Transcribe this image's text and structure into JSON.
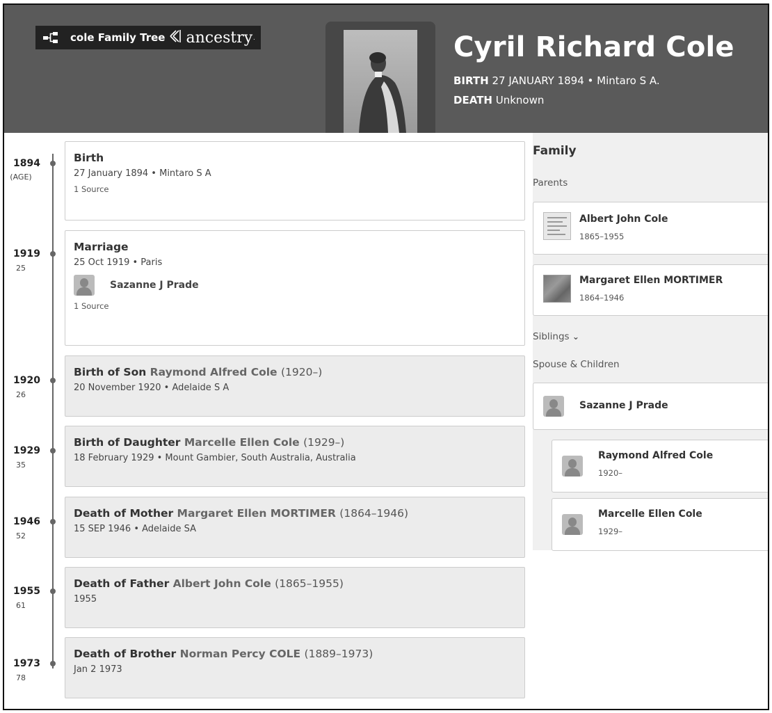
{
  "header": {
    "tree_name": "cole Family Tree",
    "brand": "ancestry",
    "person_name": "Cyril Richard Cole",
    "birth_label": "BIRTH",
    "birth_value": "27 JANUARY 1894 • Mintaro S A.",
    "death_label": "DEATH",
    "death_value": "Unknown"
  },
  "timeline": [
    {
      "year": "1894",
      "age": "(AGE)",
      "title": "Birth",
      "sub": "27 January 1894 • Mintaro S A",
      "source": "1 Source"
    },
    {
      "year": "1919",
      "age": "25",
      "title": "Marriage",
      "sub": "25 Oct 1919 • Paris",
      "spouse": "Sazanne J Prade",
      "source": "1 Source"
    },
    {
      "year": "1920",
      "age": "26",
      "title": "Birth of Son",
      "rel_name": "Raymond Alfred Cole",
      "dates": "(1920–)",
      "sub": "20 November 1920 • Adelaide S A"
    },
    {
      "year": "1929",
      "age": "35",
      "title": "Birth of Daughter",
      "rel_name": "Marcelle Ellen Cole",
      "dates": "(1929–)",
      "sub": "18 February 1929 • Mount Gambier, South Australia, Australia"
    },
    {
      "year": "1946",
      "age": "52",
      "title": "Death of Mother",
      "rel_name": "Margaret Ellen MORTIMER",
      "dates": "(1864–1946)",
      "sub": "15 SEP 1946 • Adelaide SA"
    },
    {
      "year": "1955",
      "age": "61",
      "title": "Death of Father",
      "rel_name": "Albert John Cole",
      "dates": "(1865–1955)",
      "sub": "1955"
    },
    {
      "year": "1973",
      "age": "78",
      "title": "Death of Brother",
      "rel_name": "Norman Percy COLE",
      "dates": "(1889–1973)",
      "sub": "Jan 2 1973"
    }
  ],
  "family": {
    "title": "Family",
    "parents_label": "Parents",
    "parents": [
      {
        "name": "Albert John Cole",
        "years": "1865–1955"
      },
      {
        "name": "Margaret Ellen MORTIMER",
        "years": "1864–1946"
      }
    ],
    "siblings_label": "Siblings",
    "spouse_children_label": "Spouse & Children",
    "spouse": {
      "name": "Sazanne J Prade"
    },
    "children": [
      {
        "name": "Raymond Alfred Cole",
        "years": "1920–"
      },
      {
        "name": "Marcelle Ellen Cole",
        "years": "1929–"
      }
    ]
  }
}
